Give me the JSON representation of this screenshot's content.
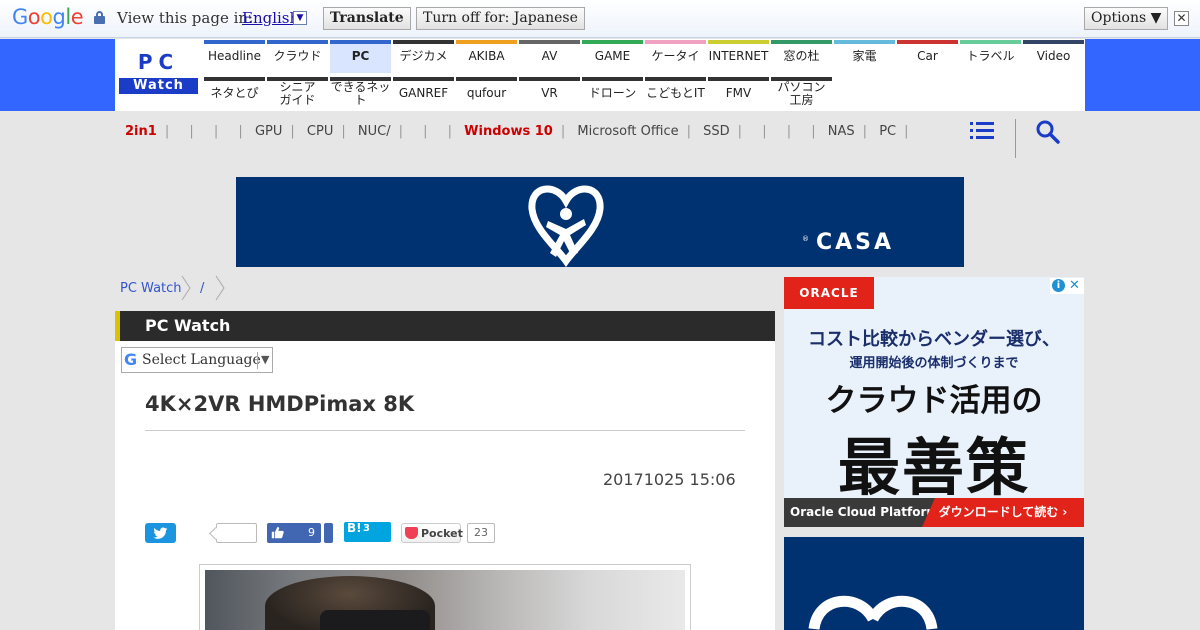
{
  "translate_bar": {
    "logo_text": "Google",
    "prompt": "View this page in:",
    "language": "English",
    "translate_label": "Translate",
    "turn_off_label": "Turn off for: Japanese",
    "options_label": "Options ▼",
    "close_glyph": "✕"
  },
  "site": {
    "logo_top": "PC",
    "logo_bottom": "Watch"
  },
  "nav": {
    "row1": [
      {
        "label": "Headline",
        "color": "#3366cc"
      },
      {
        "label": "クラウド",
        "color": "#3366cc"
      },
      {
        "label": "PC",
        "color": "#3366cc",
        "active": true
      },
      {
        "label": "デジカメ",
        "color": "#333333"
      },
      {
        "label": "AKIBA",
        "color": "#f0a020"
      },
      {
        "label": "AV",
        "color": "#666666"
      },
      {
        "label": "GAME",
        "color": "#33aa55"
      },
      {
        "label": "ケータイ",
        "color": "#f0a0c0"
      },
      {
        "label": "INTERNET",
        "color": "#cccc33"
      },
      {
        "label": "窓の杜",
        "color": "#339966"
      },
      {
        "label": "家電",
        "color": "#66bbdd"
      },
      {
        "label": "Car",
        "color": "#cc3333"
      },
      {
        "label": "トラベル",
        "color": "#66cc99"
      },
      {
        "label": "Video",
        "color": "#334466"
      }
    ],
    "row2": [
      {
        "label": "ネタとぴ",
        "color": "#333333"
      },
      {
        "label": "シニア ガイド",
        "color": "#333333"
      },
      {
        "label": "できるネット",
        "color": "#333333"
      },
      {
        "label": "GANREF",
        "color": "#333333"
      },
      {
        "label": "qufour",
        "color": "#333333"
      },
      {
        "label": "VR",
        "color": "#333333"
      },
      {
        "label": "ドローン",
        "color": "#333333"
      },
      {
        "label": "こどもとIT",
        "color": "#333333"
      },
      {
        "label": "FMV",
        "color": "#333333"
      },
      {
        "label": "パソコン 工房",
        "color": "#333333"
      }
    ]
  },
  "subnav": {
    "items": [
      "2in1",
      "",
      "",
      "",
      "GPU",
      "CPU",
      "NUC/",
      "",
      "",
      "Windows 10",
      "Microsoft Office",
      "SSD",
      "",
      "",
      "",
      "NAS",
      "PC"
    ],
    "highlighted": [
      "2in1",
      "Windows 10"
    ]
  },
  "top_ad": {
    "brand": "CASA",
    "reg": "®"
  },
  "breadcrumb": {
    "home": "PC Watch",
    "current": "/"
  },
  "category": {
    "title": "PC Watch"
  },
  "language_select": {
    "g": "G",
    "label": "Select Language",
    "arrow": "▼"
  },
  "article": {
    "title": "4K×2VR HMDPimax 8K",
    "date": "20171025 15:06"
  },
  "social": {
    "facebook_count": "9",
    "hatena_label": "B!",
    "hatena_count": "3",
    "pocket_label": "Pocket",
    "pocket_count": "23"
  },
  "side_ad": {
    "brand": "ORACLE",
    "line1": "コスト比較からベンダー選び、",
    "line2": "運用開始後の体制づくりまで",
    "line3": "クラウド活用の",
    "line4": "最善策",
    "footer_left": "Oracle Cloud Platform",
    "footer_right": "ダウンロードして読む ›",
    "adchoice_i": "i",
    "adchoice_x": "✕"
  }
}
